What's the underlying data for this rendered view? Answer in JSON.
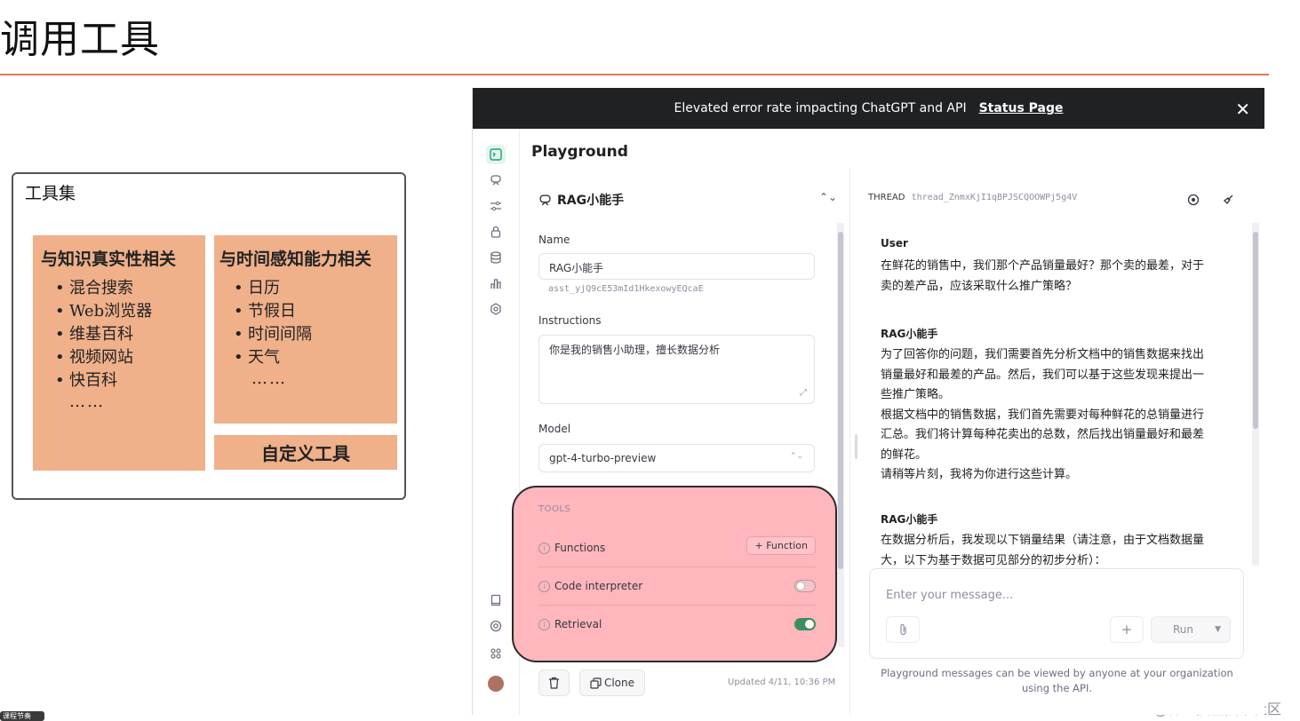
{
  "slide": {
    "title": "调用工具",
    "toolset_title": "工具集",
    "knowledge": {
      "heading": "与知识真实性相关",
      "items": [
        "混合搜索",
        "Web浏览器",
        "维基百科",
        "视频网站",
        "快百科"
      ],
      "more": "……"
    },
    "time": {
      "heading": "与时间感知能力相关",
      "items": [
        "日历",
        "节假日",
        "时间间隔",
        "天气"
      ],
      "more": "……"
    },
    "custom": "自定义工具",
    "watermark": "@稀土掘金技术社区",
    "corner_tag": "课程节奏"
  },
  "banner": {
    "message": "Elevated error rate impacting ChatGPT and API",
    "link": "Status Page",
    "close": "✕"
  },
  "app": {
    "title": "Playground"
  },
  "assistant": {
    "name": "RAG小能手",
    "name_label": "Name",
    "name_value": "RAG小能手",
    "id": "asst_yjQ9cE53mId1HkexowyEQcaE",
    "instructions_label": "Instructions",
    "instructions_value": "你是我的销售小助理，擅长数据分析",
    "model_label": "Model",
    "model_value": "gpt-4-turbo-preview",
    "tools_label": "TOOLS",
    "tools": [
      {
        "label": "Functions",
        "action": "+ Function"
      },
      {
        "label": "Code interpreter",
        "enabled": false
      },
      {
        "label": "Retrieval",
        "enabled": true
      }
    ],
    "clone_label": "Clone",
    "updated": "Updated 4/11, 10:36 PM"
  },
  "thread": {
    "label": "THREAD",
    "id": "thread_ZnmxKjI1qBPJSCQOOWPj5g4V",
    "messages": [
      {
        "role": "User",
        "text": "在鲜花的销售中，我们那个产品销量最好？那个卖的最差，对于卖的差产品，应该采取什么推广策略？"
      },
      {
        "role": "RAG小能手",
        "text": "为了回答你的问题，我们需要首先分析文档中的销售数据来找出销量最好和最差的产品。然后，我们可以基于这些发现来提出一些推广策略。\n根据文档中的销售数据，我们首先需要对每种鲜花的总销量进行汇总。我们将计算每种花卖出的总数，然后找出销量最好和最差的鲜花。\n请稍等片刻，我将为你进行这些计算。"
      },
      {
        "role": "RAG小能手",
        "text": "在数据分析后，我发现以下销量结果（请注意，由于文档数据量大，以下为基于数据可见部分的初步分析）："
      }
    ],
    "placeholder": "Enter your message...",
    "add_label": "+",
    "run_label": "Run",
    "disclaimer": "Playground messages can be viewed by anyone at your organization using the API."
  },
  "colors": {
    "accent": "#10a37f",
    "tools_highlight": "#ffb6bd",
    "peach": "#efb08a",
    "rule": "#e07a4f"
  }
}
